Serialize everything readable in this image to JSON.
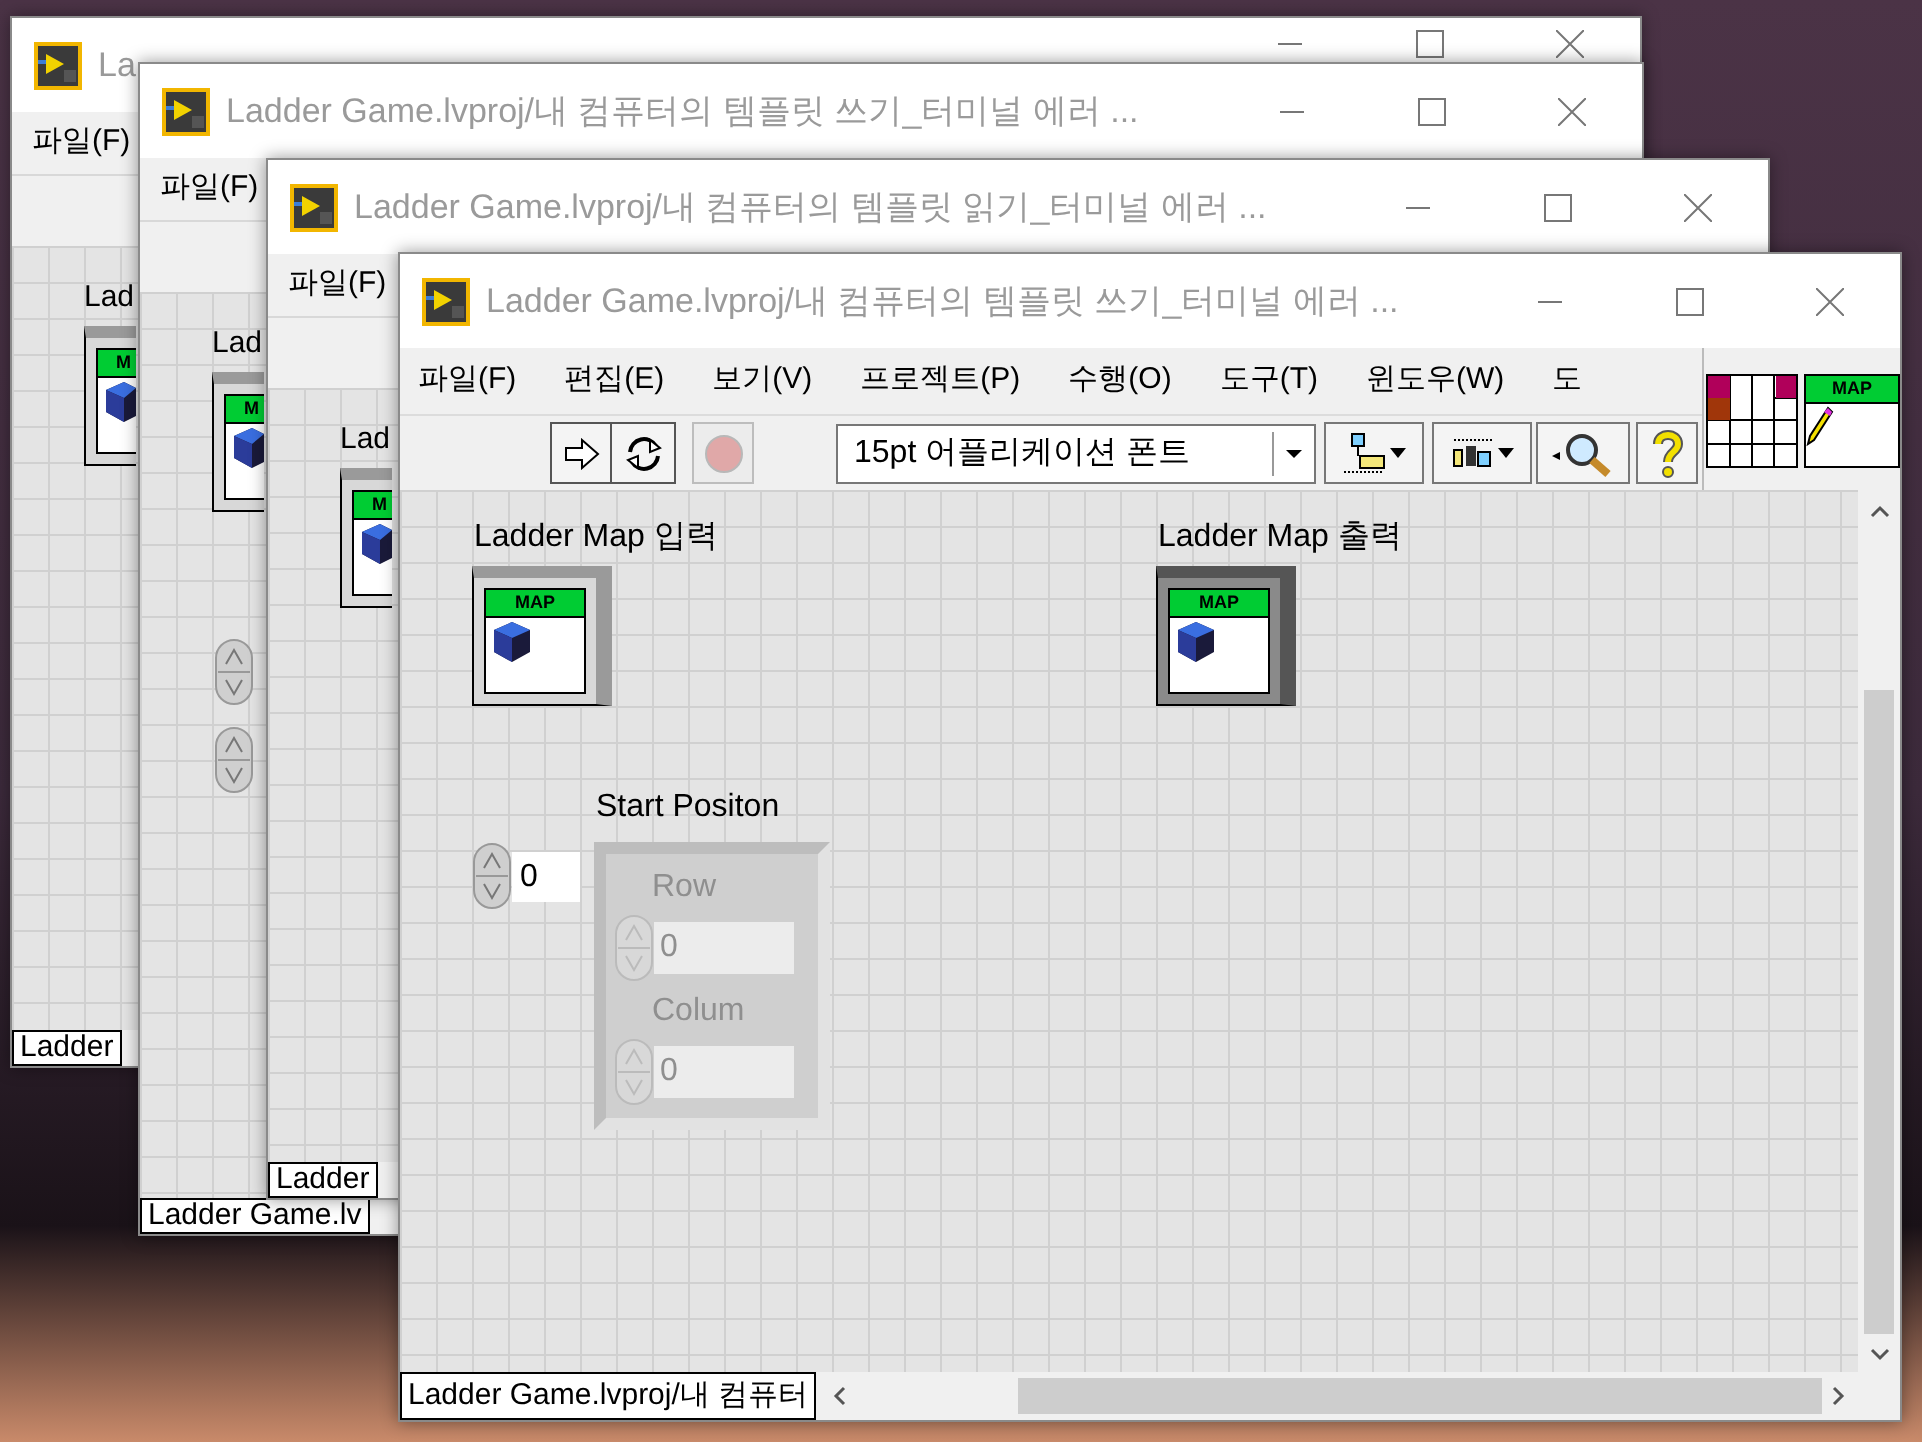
{
  "windows": [
    {
      "title": "La",
      "menu": [
        "파일(F)"
      ],
      "items": [
        {
          "kind": "label",
          "text": "Lad"
        },
        {
          "kind": "map",
          "tag": "M"
        }
      ],
      "status": "Ladder"
    },
    {
      "title": "Ladder Game.lvproj/내 컴퓨터의 템플릿 쓰기_터미널 에러 ...",
      "menu": [
        "파일(F)"
      ],
      "items": [
        {
          "kind": "label",
          "text": "Lad"
        },
        {
          "kind": "map",
          "tag": "M"
        },
        {
          "kind": "spinner"
        },
        {
          "kind": "spinner"
        }
      ],
      "status": "Ladder Game.lv"
    },
    {
      "title": "Ladder Game.lvproj/내 컴퓨터의 템플릿 읽기_터미널 에러 ...",
      "menu": [
        "파일(F)"
      ],
      "items": [
        {
          "kind": "label",
          "text": "Lad"
        },
        {
          "kind": "map",
          "tag": "M"
        }
      ],
      "status": "Ladder"
    }
  ],
  "front": {
    "title": "Ladder Game.lvproj/내 컴퓨터의 템플릿 쓰기_터미널 에러 ...",
    "menu": [
      "파일(F)",
      "편집(E)",
      "보기(V)",
      "프로젝트(P)",
      "수행(O)",
      "도구(T)",
      "윈도우(W)",
      "도"
    ],
    "toolbar": {
      "abort_disabled": true,
      "font": "15pt 어플리케이션 폰트"
    },
    "vi_icon_tag": "MAP",
    "terminals": [
      {
        "kind": "control",
        "label": "Ladder Map 입력",
        "tag": "MAP"
      },
      {
        "kind": "indicator",
        "label": "Ladder Map 출력",
        "tag": "MAP"
      }
    ],
    "start": {
      "value": "0"
    },
    "cluster": {
      "label": "Start Positon",
      "disabled": true,
      "fields": [
        {
          "label": "Row",
          "value": "0"
        },
        {
          "label": "Colum",
          "value": "0"
        }
      ]
    },
    "status": "Ladder Game.lvproj/내 컴퓨터"
  }
}
